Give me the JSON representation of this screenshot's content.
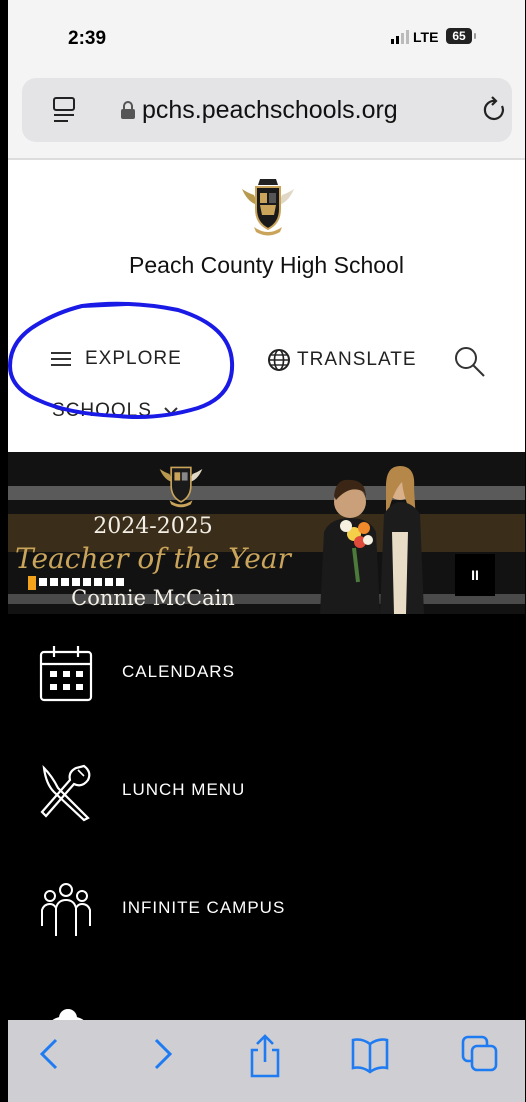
{
  "status_bar": {
    "time": "2:39",
    "network": "LTE",
    "battery": "65"
  },
  "browser": {
    "url": "pchs.peachschools.org"
  },
  "page": {
    "school_name": "Peach County High School",
    "nav": {
      "explore": "EXPLORE",
      "translate": "TRANSLATE",
      "schools": "SCHOOLS"
    }
  },
  "banner": {
    "year": "2024-2025",
    "title": "Teacher of the Year",
    "name": "Connie McCain",
    "slide_count": 9,
    "active_slide": 1,
    "pause_label": "II"
  },
  "quick_links": [
    {
      "label": "CALENDARS",
      "icon": "calendar-icon"
    },
    {
      "label": "LUNCH MENU",
      "icon": "fork-knife-icon"
    },
    {
      "label": "INFINITE CAMPUS",
      "icon": "people-icon"
    }
  ],
  "colors": {
    "accent_gold": "#c9a45a",
    "annotation_blue": "#1a1ae6",
    "slide_active": "#f2a21b"
  }
}
